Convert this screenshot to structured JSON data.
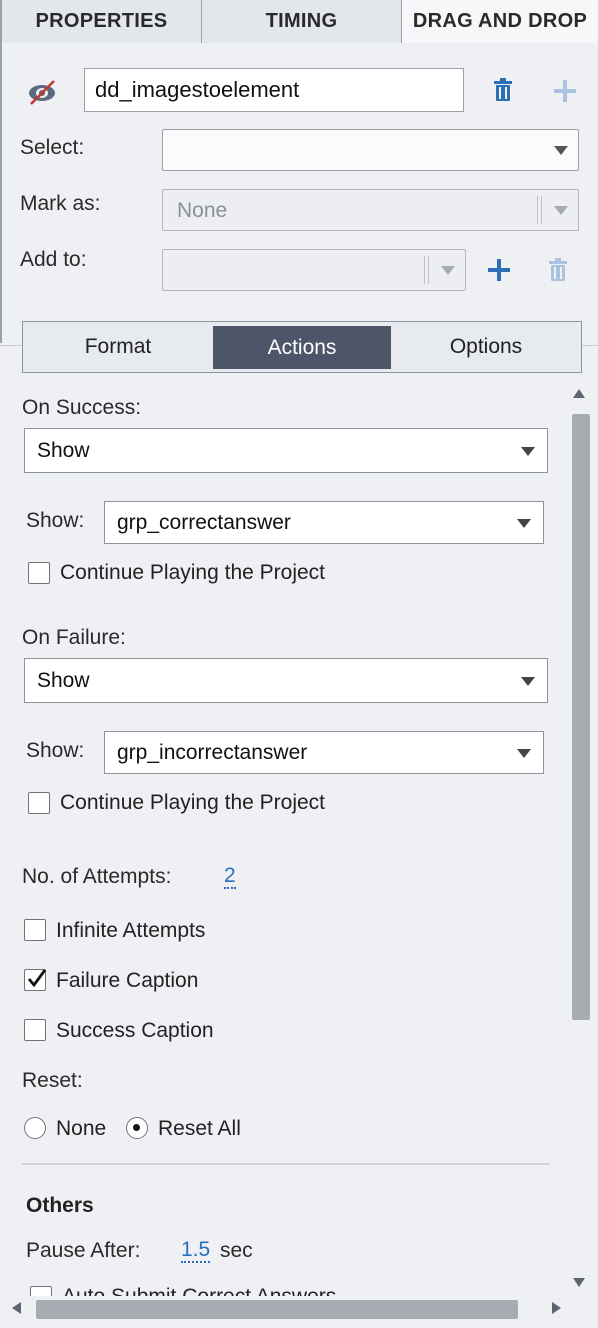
{
  "top_tabs": {
    "properties": "PROPERTIES",
    "timing": "TIMING",
    "drag_and_drop": "DRAG AND DROP"
  },
  "interaction": {
    "name_value": "dd_imagestoelement",
    "visibility_icon": "eye-hidden-icon",
    "delete_icon": "trash-icon",
    "add_icon": "plus-icon"
  },
  "fields": {
    "select_label": "Select:",
    "select_value": "",
    "mark_as_label": "Mark as:",
    "mark_as_value": "None",
    "add_to_label": "Add to:",
    "add_to_value": ""
  },
  "sub_tabs": {
    "format": "Format",
    "actions": "Actions",
    "options": "Options",
    "active": "Actions"
  },
  "actions": {
    "on_success_label": "On Success:",
    "on_success_value": "Show",
    "success_show_label": "Show:",
    "success_show_value": "grp_correctanswer",
    "success_continue_label": "Continue Playing the Project",
    "success_continue_checked": false,
    "on_failure_label": "On Failure:",
    "on_failure_value": "Show",
    "failure_show_label": "Show:",
    "failure_show_value": "grp_incorrectanswer",
    "failure_continue_label": "Continue Playing the Project",
    "failure_continue_checked": false,
    "attempts_label": "No. of Attempts:",
    "attempts_value": "2",
    "infinite_label": "Infinite Attempts",
    "infinite_checked": false,
    "failure_caption_label": "Failure Caption",
    "failure_caption_checked": true,
    "success_caption_label": "Success Caption",
    "success_caption_checked": false,
    "reset_label": "Reset:",
    "reset_none_label": "None",
    "reset_all_label": "Reset All",
    "reset_selected": "Reset All"
  },
  "others": {
    "heading": "Others",
    "pause_after_label": "Pause After:",
    "pause_after_value": "1.5",
    "pause_after_unit": "sec",
    "auto_submit_label": "Auto Submit Correct Answers"
  },
  "colors": {
    "accent_blue": "#2a6fbf",
    "active_tab": "#4d5569",
    "panel_bg": "#eef0f4"
  }
}
